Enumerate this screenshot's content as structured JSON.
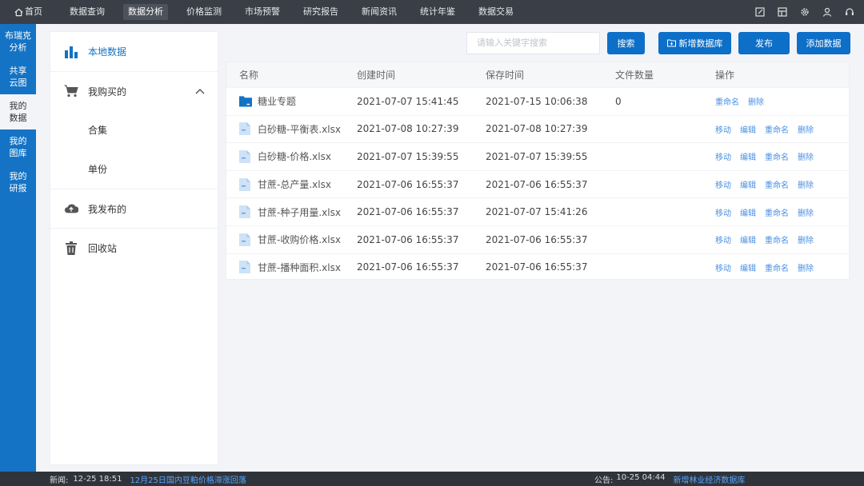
{
  "topnav": {
    "home": "首页",
    "items": [
      "数据查询",
      "数据分析",
      "价格监测",
      "市场预警",
      "研究报告",
      "新闻资讯",
      "统计年鉴",
      "数据交易"
    ],
    "active_index": 1
  },
  "leftbar": {
    "items": [
      {
        "line1": "布瑞克",
        "line2": "分析"
      },
      {
        "line1": "共享",
        "line2": "云图"
      },
      {
        "line1": "我的",
        "line2": "数据"
      },
      {
        "line1": "我的",
        "line2": "图库"
      },
      {
        "line1": "我的",
        "line2": "研报"
      }
    ],
    "active_index": 2
  },
  "sidepanel": {
    "local_data": "本地数据",
    "purchased": "我购买的",
    "collection": "合集",
    "single": "单份",
    "published": "我发布的",
    "recycle": "回收站"
  },
  "toolbar": {
    "search_placeholder": "请输入关键字搜索",
    "search_btn": "搜索",
    "new_db_btn": "新增数据库",
    "publish_btn": "发布",
    "add_data_btn": "添加数据"
  },
  "table": {
    "headers": {
      "name": "名称",
      "created": "创建时间",
      "saved": "保存时间",
      "count": "文件数量",
      "ops": "操作"
    },
    "rows": [
      {
        "type": "folder",
        "name": "糖业专题",
        "created": "2021-07-07 15:41:45",
        "saved": "2021-07-15 10:06:38",
        "count": "0",
        "ops": [
          "重命名",
          "删除"
        ]
      },
      {
        "type": "file",
        "name": "白砂糖-平衡表.xlsx",
        "created": "2021-07-08 10:27:39",
        "saved": "2021-07-08 10:27:39",
        "count": "",
        "ops": [
          "移动",
          "编辑",
          "重命名",
          "删除"
        ]
      },
      {
        "type": "file",
        "name": "白砂糖-价格.xlsx",
        "created": "2021-07-07 15:39:55",
        "saved": "2021-07-07 15:39:55",
        "count": "",
        "ops": [
          "移动",
          "编辑",
          "重命名",
          "删除"
        ]
      },
      {
        "type": "file",
        "name": "甘蔗-总产量.xlsx",
        "created": "2021-07-06 16:55:37",
        "saved": "2021-07-06 16:55:37",
        "count": "",
        "ops": [
          "移动",
          "编辑",
          "重命名",
          "删除"
        ]
      },
      {
        "type": "file",
        "name": "甘蔗-种子用量.xlsx",
        "created": "2021-07-06 16:55:37",
        "saved": "2021-07-07 15:41:26",
        "count": "",
        "ops": [
          "移动",
          "编辑",
          "重命名",
          "删除"
        ]
      },
      {
        "type": "file",
        "name": "甘蔗-收购价格.xlsx",
        "created": "2021-07-06 16:55:37",
        "saved": "2021-07-06 16:55:37",
        "count": "",
        "ops": [
          "移动",
          "编辑",
          "重命名",
          "删除"
        ]
      },
      {
        "type": "file",
        "name": "甘蔗-播种面积.xlsx",
        "created": "2021-07-06 16:55:37",
        "saved": "2021-07-06 16:55:37",
        "count": "",
        "ops": [
          "移动",
          "编辑",
          "重命名",
          "删除"
        ]
      }
    ]
  },
  "bottombar": {
    "news_label": "新闻:",
    "news_time": "12-25 18:51",
    "news_link": "12月25日国内豆粕价格滞涨回落",
    "notice_label": "公告:",
    "notice_time": "10-25 04:44",
    "notice_link": "新增林业经济数据库"
  },
  "colors": {
    "accent": "#1473c4",
    "button": "#0d6fc7",
    "link": "#4a90e2",
    "topbar": "#3a3f47"
  }
}
